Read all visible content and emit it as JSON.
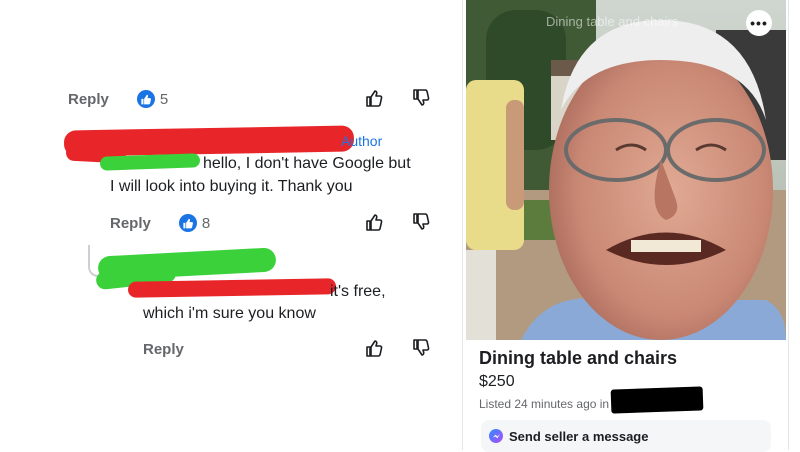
{
  "comments": {
    "first": {
      "reply_label": "Reply",
      "like_count": "5"
    },
    "second": {
      "author_label": "Author",
      "text_line1": "hello, I don't have Google but",
      "text_line2": "I will look into buying it. Thank you",
      "reply_label": "Reply",
      "like_count": "8"
    },
    "third": {
      "text_line1": "it's free,",
      "text_line2": "which i'm sure you know",
      "reply_label": "Reply"
    }
  },
  "listing": {
    "overlay_title": "Dining table and chairs",
    "title": "Dining table and chairs",
    "price": "$250",
    "listed": "Listed 24 minutes ago in",
    "message_button": "Send seller a message",
    "more_icon": "more-options-icon"
  },
  "colors": {
    "like_blue": "#1b74e4",
    "redact_red": "#e8262a",
    "redact_green": "#3bd13b",
    "muted_text": "#65676b"
  }
}
